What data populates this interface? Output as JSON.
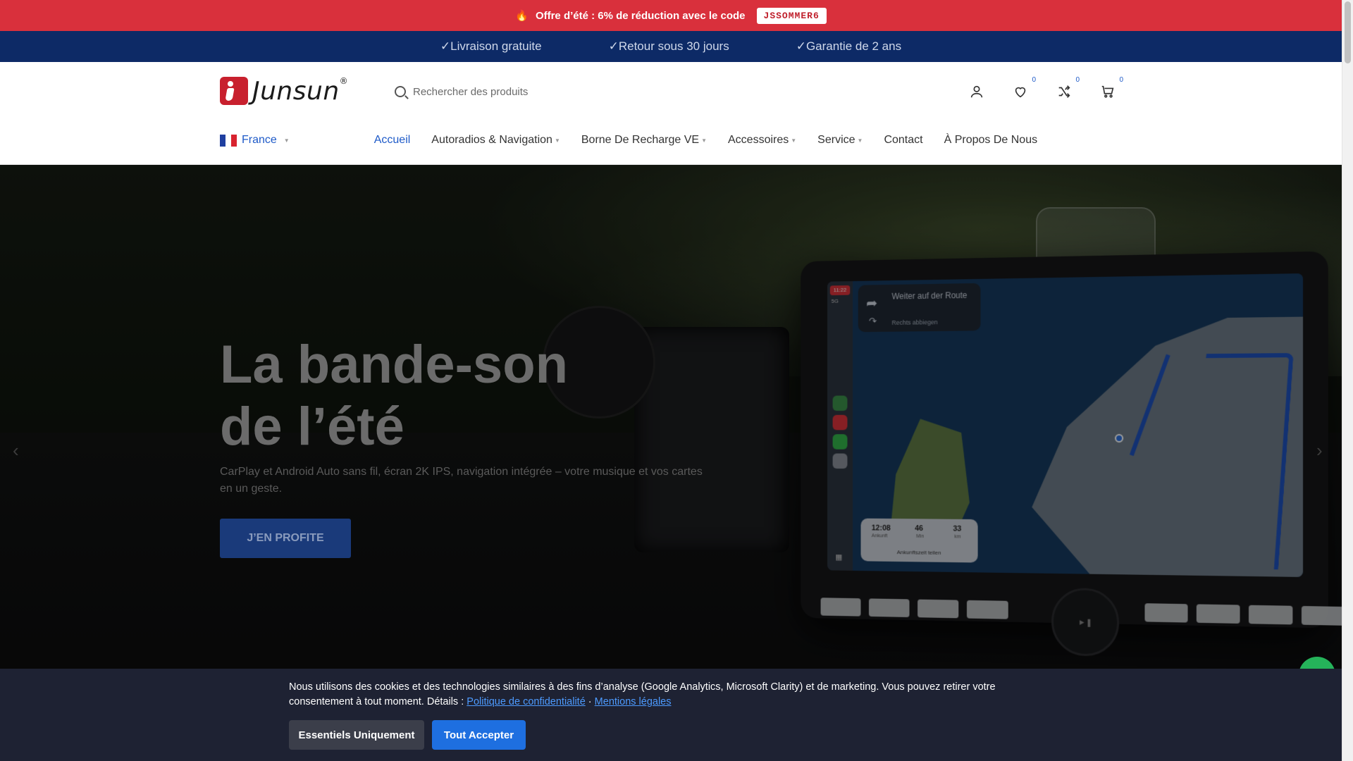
{
  "promo": {
    "text": "Offre d’été : 6% de réduction avec le code",
    "code": "JSSOMMER6"
  },
  "usp": [
    "✓Livraison gratuite",
    "✓Retour sous 30 jours",
    "✓Garantie de 2 ans"
  ],
  "header": {
    "logo_text": "Junsun",
    "logo_reg": "®",
    "search_placeholder": "Rechercher des produits",
    "wishlist_count": "0",
    "compare_count": "0",
    "cart_count": "0"
  },
  "nav": {
    "country": "France",
    "items": [
      "Accueil",
      "Autoradios & Navigation",
      "Borne De Recharge VE",
      "Accessoires",
      "Service",
      "Contact",
      "À Propos De Nous"
    ]
  },
  "hero": {
    "headline_line1": "La bande-son",
    "headline_line2": "de l’été",
    "subtitle": "CarPlay et Android Auto sans fil, écran 2K IPS, navigation intégrée – votre musique et vos cartes en un geste.",
    "cta": "J’EN PROFITE",
    "screen": {
      "nav_line1": "Weiter auf der Route",
      "nav_line2": "Rechts abbiegen",
      "status_time": "11:22",
      "status_signal": "5G",
      "eta_time": "12:08",
      "eta_time_label": "Ankunft",
      "eta_min": "46",
      "eta_min_label": "Min",
      "eta_km": "33",
      "eta_km_label": "km",
      "share": "Ankunftszeit teilen"
    }
  },
  "cookie": {
    "text": "Nous utilisons des cookies et des technologies similaires à des fins d’analyse (Google Analytics, Microsoft Clarity) et de marketing. Vous pouvez retirer votre consentement à tout moment. Détails :",
    "link_privacy": "Politique de confidentialité",
    "separator": "·",
    "link_legal": "Mentions légales",
    "btn_essential": "Essentiels Uniquement",
    "btn_accept": "Tout Accepter"
  },
  "colors": {
    "promo_bg": "#d9303c",
    "usp_bg": "#0d2a66",
    "accent": "#1e5ac8",
    "cookie_bg": "#1e2233",
    "accept_btn": "#1e6fe0"
  }
}
